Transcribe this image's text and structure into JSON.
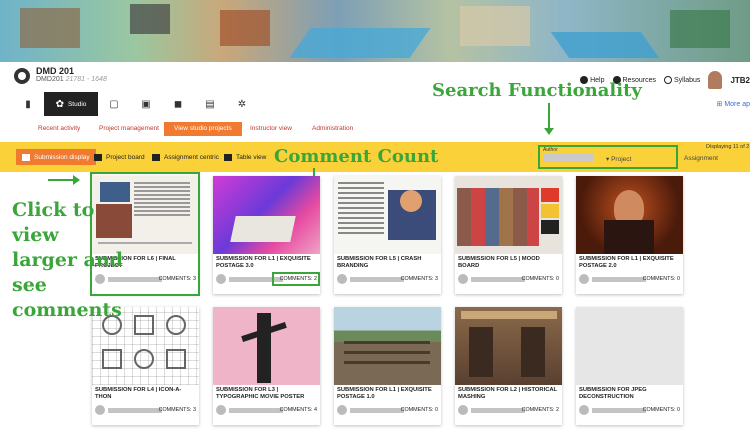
{
  "header": {
    "course_title": "DMD 201",
    "course_sub": "DMD201",
    "course_id": "21781 - 1648",
    "help": "Help",
    "resources": "Resources",
    "syllabus": "Syllabus",
    "user": "JTB2"
  },
  "tabbar": {
    "studio_label": "Studio",
    "more_apps": "More ap"
  },
  "subnav": {
    "items": [
      "Recent activity",
      "Project management",
      "View studio projects",
      "Instructor view",
      "Administration"
    ]
  },
  "toolbar": {
    "views": [
      "Submission display",
      "Project board",
      "Assignment centric",
      "Table view"
    ],
    "author_label": "Author",
    "project_label": "Project",
    "assignment_label": "Assignment",
    "displaying": "Displaying 11 of 2"
  },
  "annotations": {
    "search": "Search Functionality",
    "comment": "Comment Count",
    "click": "Click to view larger and see comments"
  },
  "cards": [
    {
      "title": "SUBMISSION FOR L6 | FINAL PROJECT",
      "comments": "COMMENTS: 3"
    },
    {
      "title": "SUBMISSION FOR L1 | EXQUISITE POSTAGE 3.0",
      "comments": "COMMENTS: 2"
    },
    {
      "title": "SUBMISSION FOR L5 | CRASH BRANDING",
      "comments": "COMMENTS: 3"
    },
    {
      "title": "SUBMISSION FOR L5 | MOOD BOARD",
      "comments": "COMMENTS: 0"
    },
    {
      "title": "SUBMISSION FOR L1 | EXQUISITE POSTAGE 2.0",
      "comments": "COMMENTS: 0"
    },
    {
      "title": "SUBMISSION FOR L4 | ICON-A-THON",
      "comments": "COMMENTS: 3"
    },
    {
      "title": "SUBMISSION FOR L3 | TYPOGRAPHIC MOVIE POSTER",
      "comments": "COMMENTS: 4"
    },
    {
      "title": "SUBMISSION FOR L1 | EXQUISITE POSTAGE 1.0",
      "comments": "COMMENTS: 0"
    },
    {
      "title": "SUBMISSION FOR L2 | HISTORICAL MASHING",
      "comments": "COMMENTS: 2"
    },
    {
      "title": "SUBMISSION FOR JPEG DECONSTRUCTION",
      "comments": "COMMENTS: 0"
    }
  ],
  "colors": {
    "accent_orange": "#f07a2f",
    "toolbar_yellow": "#fbd13a",
    "annotation_green": "#3aa63a",
    "link_red": "#c0392b"
  }
}
